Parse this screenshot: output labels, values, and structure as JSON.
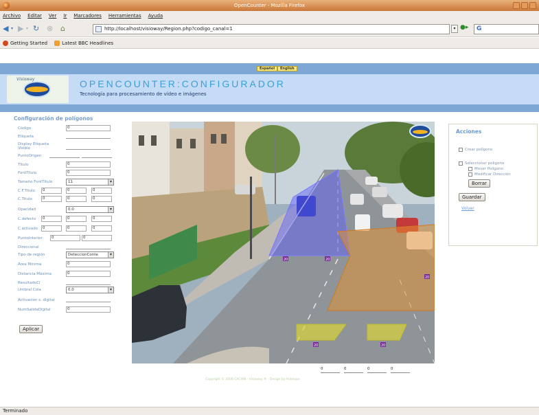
{
  "window": {
    "title": "OpenCounter - Mozilla Firefox"
  },
  "menu": [
    "Archivo",
    "Editar",
    "Ver",
    "Ir",
    "Marcadores",
    "Herramientas",
    "Ayuda"
  ],
  "url": "http://localhost/visioway/Region.php?codigo_canal=1",
  "bookmarks": [
    "Getting Started",
    "Latest BBC Headlines"
  ],
  "lang": {
    "es": "Español",
    "en": "English"
  },
  "header": {
    "logo_text": "Visioway",
    "title": "OPENCOUNTER:CONFIGURADOR",
    "subtitle": "Tecnología para procesamiento de vídeo e imágenes"
  },
  "config": {
    "title": "Configuración de polígonos",
    "labels": {
      "codigo": "Código",
      "etiqueta": "Etiqueta",
      "display": "Display Etiqueta Visible",
      "puntoorigen": "PuntoOrigen",
      "titulo": "Titulo",
      "fonttitulo": "FontTitulo",
      "tamanofont": "Tamaño FontTitulo",
      "cftitulo": "C.F.Titulo",
      "ctitulo": "C.Titulo",
      "opacidad": "Opacidad",
      "cdefecto": "C.defecto",
      "cactivado": "C.activado",
      "puntointerior": "PuntoInterior",
      "direccional": "Direccional",
      "tiporegion": "Tipo de región",
      "areaminima": "Área Mínima",
      "distancia": "Distancia Máxima",
      "resultado": "ResultadoCl",
      "umbral": "Umbral Cola",
      "activacion": "Activacion s. digital",
      "numsalida": "NumSalidaDigital"
    },
    "values": {
      "codigo": "0",
      "titulo": "0",
      "fonttitulo": "0",
      "tamanofont": "11",
      "cftitulo": [
        "0",
        "0",
        "0"
      ],
      "ctitulo": [
        "0",
        "0",
        "0"
      ],
      "opacidad": "0.0",
      "cdefecto": [
        "0",
        "0",
        "0"
      ],
      "cactivado": [
        "0",
        "0",
        "0"
      ],
      "puntointerior": [
        "0",
        "0"
      ],
      "tiporegion": "DeteccionConte",
      "areaminima": "0",
      "distancia": "0",
      "umbral": "0.0",
      "numsalida": "0"
    },
    "apply_label": "Aplicar"
  },
  "region_labels": [
    "20",
    "20",
    "20",
    "20",
    "20"
  ],
  "actions": {
    "title": "Acciones",
    "create": "Crear polígono",
    "select": "Seleccionar polígono",
    "move": "Mover Polígono",
    "modify_dir": "Modificar Dirección",
    "delete": "Borrar",
    "save": "Guardar",
    "back": "Volver"
  },
  "coords": [
    "0",
    "0",
    "0",
    "0"
  ],
  "copyright": "Copyright © 2008 CACIAN - Visioway ® - Design by Antelope",
  "status": "Terminado",
  "colors": {
    "accent": "#7fa7d6",
    "header_bg": "#c6dbf5",
    "title": "#3aa0d8",
    "region_blue": "#5a5cff",
    "region_orange": "#e8912e",
    "region_yellow": "#d9d43a"
  }
}
